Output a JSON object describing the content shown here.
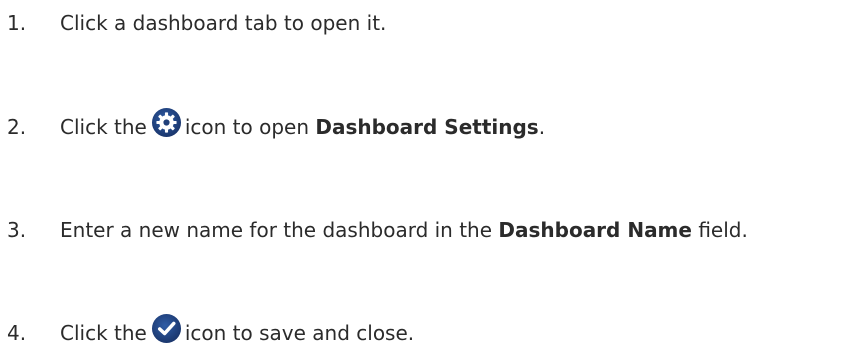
{
  "steps": [
    {
      "number": "1.",
      "text": "Click a dashboard tab to open it."
    },
    {
      "number": "2.",
      "before": "Click the",
      "icon": "gear-icon",
      "after": "icon to open",
      "bold": "Dashboard Settings",
      "end": "."
    },
    {
      "number": "3.",
      "before": "Enter a new name for the dashboard in the",
      "bold": "Dashboard Name",
      "end": "field."
    },
    {
      "number": "4.",
      "before": "Click the",
      "icon": "checkmark-icon",
      "after": "icon to save and close."
    }
  ],
  "colors": {
    "text": "#2b2b2b",
    "icon_fill": "#20407a",
    "icon_glyph": "#ffffff"
  }
}
